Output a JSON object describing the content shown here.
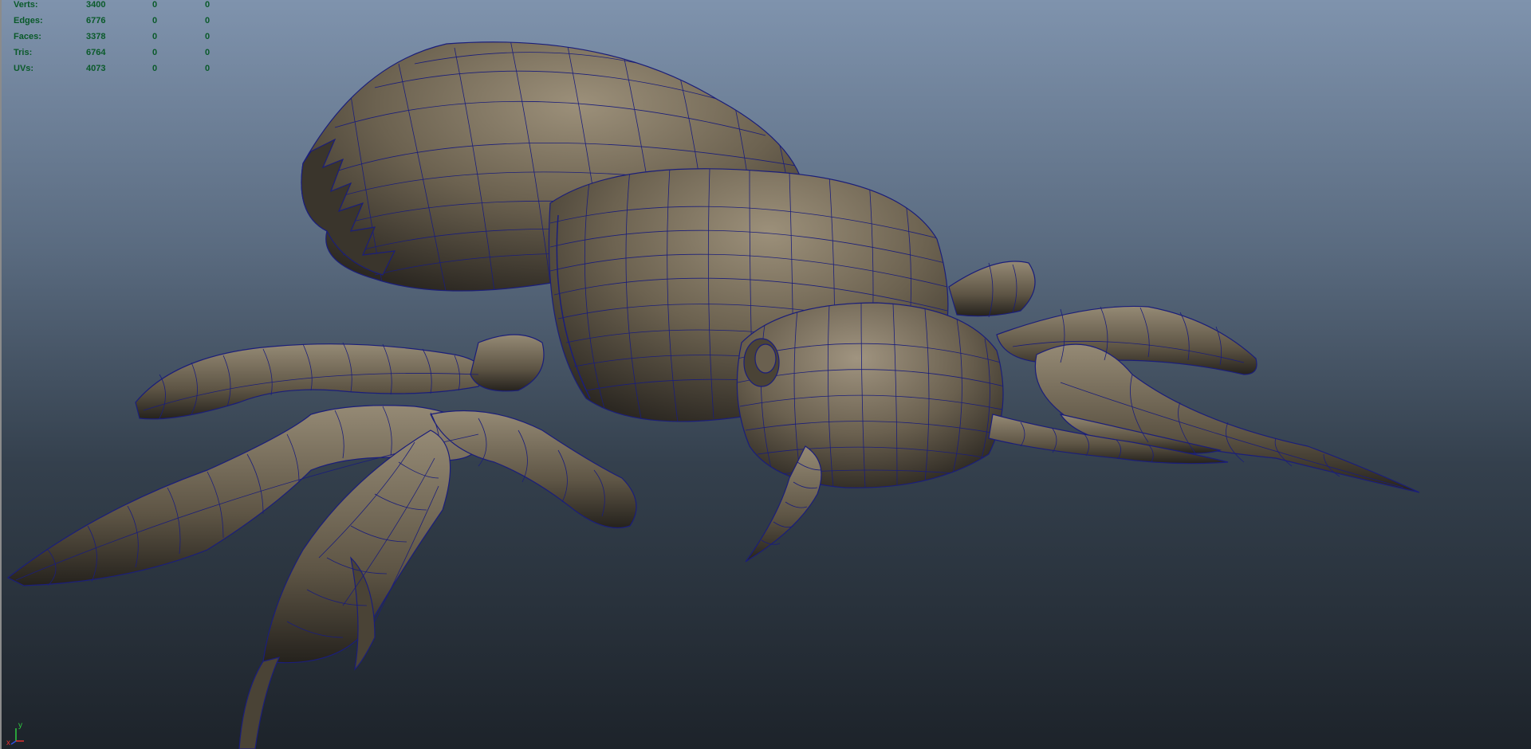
{
  "hud": {
    "rows": [
      {
        "label": "Verts:",
        "c1": "3400",
        "c2": "0",
        "c3": "0"
      },
      {
        "label": "Edges:",
        "c1": "6776",
        "c2": "0",
        "c3": "0"
      },
      {
        "label": "Faces:",
        "c1": "3378",
        "c2": "0",
        "c3": "0"
      },
      {
        "label": "Tris:",
        "c1": "6764",
        "c2": "0",
        "c3": "0"
      },
      {
        "label": "UVs:",
        "c1": "4073",
        "c2": "0",
        "c3": "0"
      }
    ]
  },
  "axis": {
    "x_label": "x",
    "y_label": "y"
  },
  "colors": {
    "wire": "#1b1e7a",
    "skin": "#6d6352",
    "skin_light": "#9a8e78",
    "skin_dark": "#2e2a23",
    "hud_text": "#0a5a2a"
  }
}
